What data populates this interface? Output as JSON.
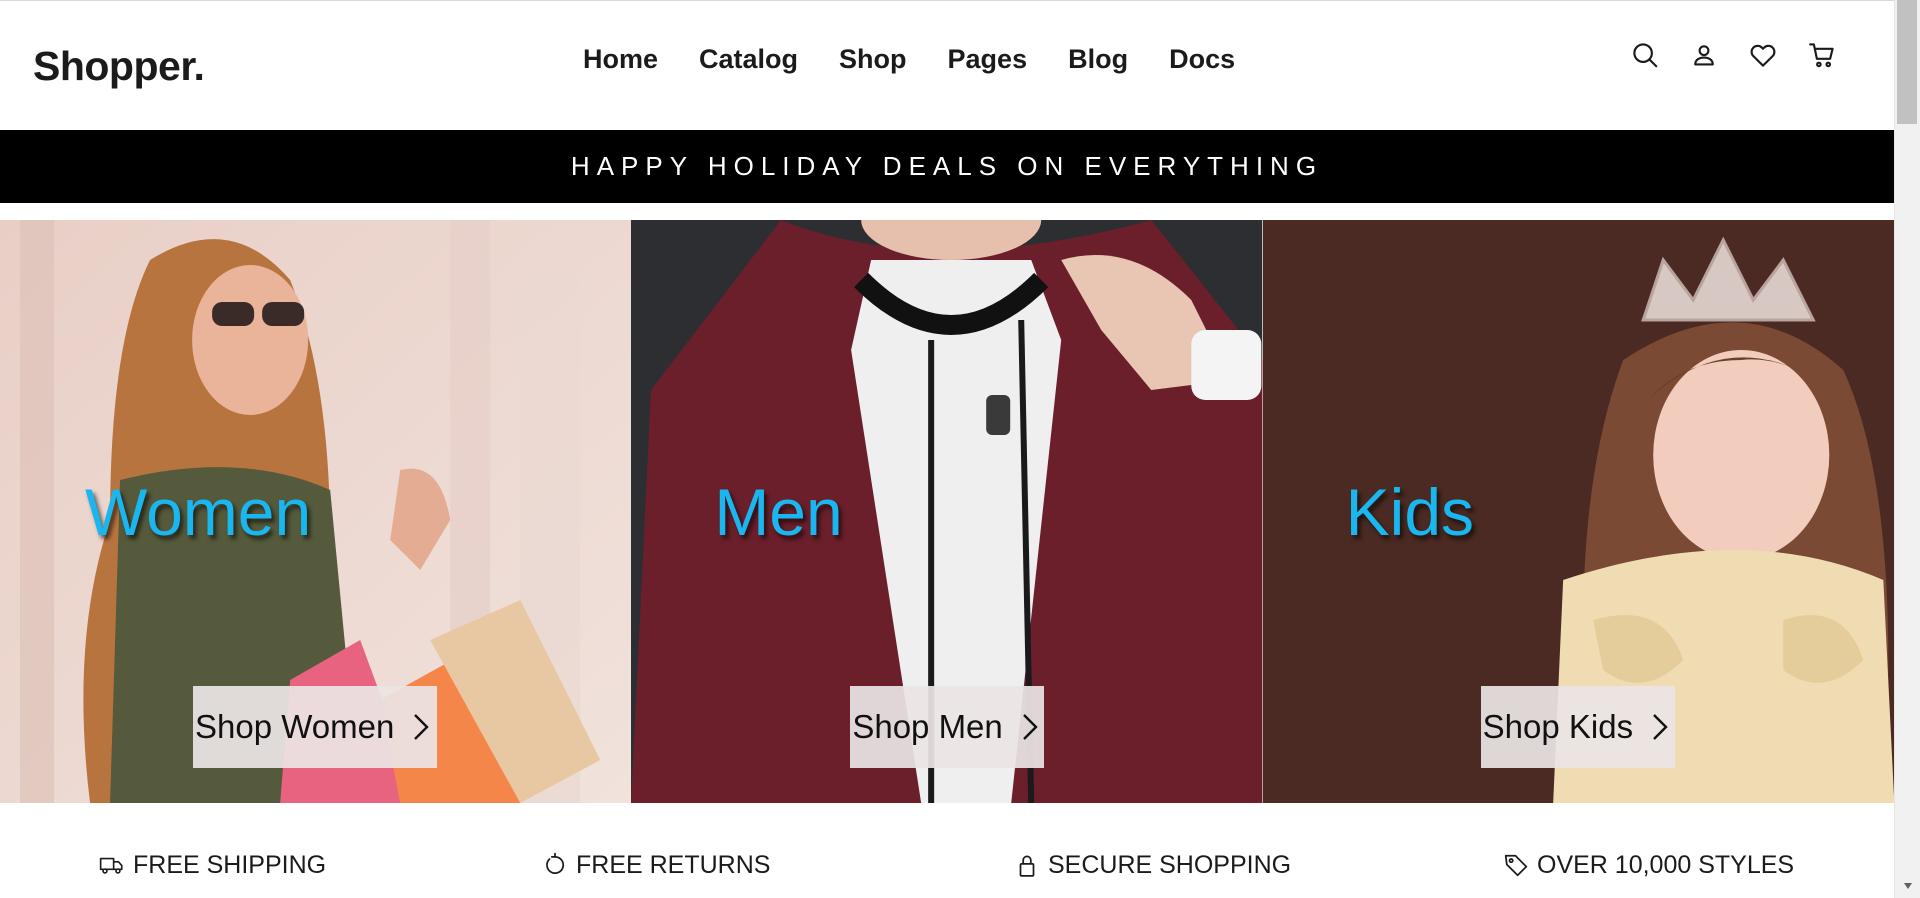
{
  "header": {
    "logo": "Shopper.",
    "nav": [
      {
        "label": "Home"
      },
      {
        "label": "Catalog"
      },
      {
        "label": "Shop"
      },
      {
        "label": "Pages"
      },
      {
        "label": "Blog"
      },
      {
        "label": "Docs"
      }
    ],
    "icons": [
      "search-icon",
      "user-icon",
      "heart-icon",
      "cart-icon"
    ]
  },
  "promo": {
    "text": "HAPPY HOLIDAY DEALS ON EVERYTHING"
  },
  "categories": [
    {
      "title": "Women",
      "button": "Shop Women"
    },
    {
      "title": "Men",
      "button": "Shop Men"
    },
    {
      "title": "Kids",
      "button": "Shop Kids"
    }
  ],
  "features": [
    {
      "icon": "truck-icon",
      "label": "FREE SHIPPING"
    },
    {
      "icon": "refresh-icon",
      "label": "FREE RETURNS"
    },
    {
      "icon": "lock-icon",
      "label": "SECURE SHOPPING"
    },
    {
      "icon": "tag-icon",
      "label": "OVER 10,000 STYLES"
    }
  ],
  "colors": {
    "accent": "#1ab6ef",
    "promo_bg": "#000000",
    "text": "#1b1b1b"
  }
}
